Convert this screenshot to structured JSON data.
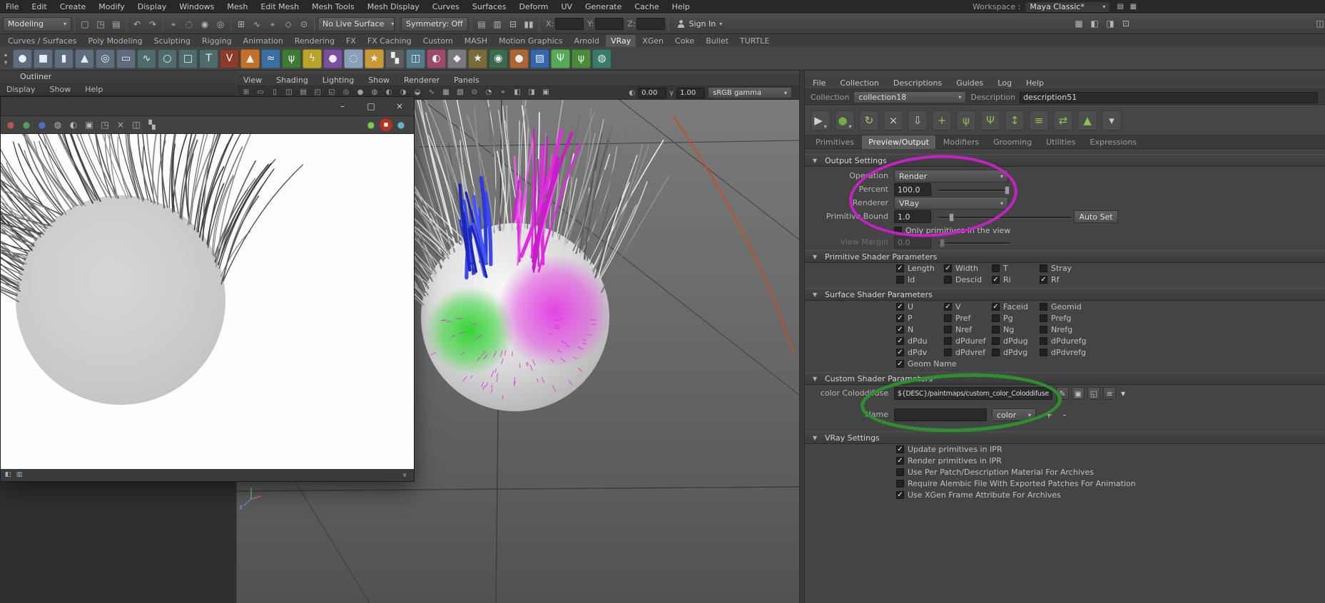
{
  "app": {
    "workspace_label": "Workspace :",
    "workspace_value": "Maya Classic*"
  },
  "menubar": {
    "items": [
      "File",
      "Edit",
      "Create",
      "Modify",
      "Display",
      "Windows",
      "Mesh",
      "Edit Mesh",
      "Mesh Tools",
      "Mesh Display",
      "Curves",
      "Surfaces",
      "Deform",
      "UV",
      "Generate",
      "Cache",
      "Help"
    ],
    "right_icons": [
      {
        "name": "workspace-options-icon",
        "glyph": "▤"
      },
      {
        "name": "layout-switch-icon",
        "glyph": "▦"
      }
    ]
  },
  "statusline": {
    "mode": "Modeling",
    "no_live_surface": "No Live Surface",
    "symmetry": "Symmetry: Off",
    "sign_in_label": "Sign In",
    "far_right_icon_glyph": "◫",
    "coords": {
      "x_label": "X:",
      "y_label": "Y:",
      "z_label": "Z:"
    },
    "file_icons": [
      {
        "name": "new-scene-icon",
        "glyph": "▢"
      },
      {
        "name": "open-scene-icon",
        "glyph": "◳"
      },
      {
        "name": "save-scene-icon",
        "glyph": "▤"
      }
    ],
    "undo_icons": [
      {
        "name": "undo-icon",
        "glyph": "↶"
      },
      {
        "name": "redo-icon",
        "glyph": "↷"
      }
    ],
    "select_icons": [
      {
        "name": "select-tool-icon",
        "glyph": "⌖"
      },
      {
        "name": "lasso-select-icon",
        "glyph": "◌"
      },
      {
        "name": "select-hierarchy-icon",
        "glyph": "◉"
      },
      {
        "name": "select-object-icon",
        "glyph": "◎"
      }
    ],
    "snap_icons": [
      {
        "name": "snap-grid-icon",
        "glyph": "⊞"
      },
      {
        "name": "snap-curve-icon",
        "glyph": "∿"
      },
      {
        "name": "snap-point-icon",
        "glyph": "⌖"
      },
      {
        "name": "snap-plane-icon",
        "glyph": "◇"
      },
      {
        "name": "snap-surface-icon",
        "glyph": "⊙"
      }
    ],
    "history_icons": [
      {
        "name": "construction-history-icon",
        "glyph": "▤"
      },
      {
        "name": "selection-highlight-icon",
        "glyph": "▥"
      },
      {
        "name": "evaluation-icon",
        "glyph": "⊟"
      },
      {
        "name": "pause-evaluation-icon",
        "glyph": "▮▮"
      }
    ],
    "render_icons": [
      {
        "name": "open-render-view-icon",
        "glyph": "▦"
      },
      {
        "name": "render-frame-icon",
        "glyph": "◧"
      },
      {
        "name": "ipr-render-icon",
        "glyph": "◨"
      },
      {
        "name": "render-settings-icon",
        "glyph": "⊡"
      }
    ]
  },
  "shelf": {
    "active_tab": "VRay",
    "tabs": [
      "Curves / Surfaces",
      "Poly Modeling",
      "Sculpting",
      "Rigging",
      "Animation",
      "Rendering",
      "FX",
      "FX Caching",
      "Custom",
      "MASH",
      "Motion Graphics",
      "Arnold",
      "VRay",
      "XGen",
      "Coke",
      "Bullet",
      "TURTLE"
    ],
    "left_icons": [
      {
        "name": "shelf-scroll-up-icon",
        "glyph": "▴"
      },
      {
        "name": "shelf-scroll-down-icon",
        "glyph": "▾"
      }
    ],
    "icons": [
      {
        "name": "shelf-sphere-icon",
        "glyph": "●",
        "color": "#5d6d7d"
      },
      {
        "name": "shelf-cube-icon",
        "glyph": "■",
        "color": "#5d6d7d"
      },
      {
        "name": "shelf-cylinder-icon",
        "glyph": "▮",
        "color": "#5d6d7d"
      },
      {
        "name": "shelf-cone-icon",
        "glyph": "▲",
        "color": "#5d6d7d"
      },
      {
        "name": "shelf-torus-icon",
        "glyph": "◎",
        "color": "#5d6d7d"
      },
      {
        "name": "shelf-plane-icon",
        "glyph": "▭",
        "color": "#5d6d7d"
      },
      {
        "name": "shelf-curve-icon",
        "glyph": "∿",
        "color": "#4f6a6a"
      },
      {
        "name": "shelf-circle-icon",
        "glyph": "○",
        "color": "#4f6a6a"
      },
      {
        "name": "shelf-square-icon",
        "glyph": "□",
        "color": "#4f6a6a"
      },
      {
        "name": "shelf-text-icon",
        "glyph": "T",
        "color": "#4f6a6a"
      },
      {
        "name": "shelf-vray-icon",
        "glyph": "V",
        "color": "#8a3b2a"
      },
      {
        "name": "shelf-fire-icon",
        "glyph": "▲",
        "color": "#c4702b"
      },
      {
        "name": "shelf-water-icon",
        "glyph": "≈",
        "color": "#3b6fa0"
      },
      {
        "name": "shelf-grass-icon",
        "glyph": "ψ",
        "color": "#3f7a35"
      },
      {
        "name": "shelf-lightning-icon",
        "glyph": "ϟ",
        "color": "#b8a42b"
      },
      {
        "name": "shelf-purple-sphere-icon",
        "glyph": "●",
        "color": "#7a4fa0"
      },
      {
        "name": "shelf-cloud-icon",
        "glyph": "◌",
        "color": "#8aa0b8"
      },
      {
        "name": "shelf-sun-icon",
        "glyph": "★",
        "color": "#c79a35"
      },
      {
        "name": "shelf-checker-icon",
        "glyph": "▚",
        "color": "#5d5d5d"
      },
      {
        "name": "shelf-glass-icon",
        "glyph": "◫",
        "color": "#527a8a"
      },
      {
        "name": "shelf-shader-ball-icon",
        "glyph": "◐",
        "color": "#9a4a6a"
      },
      {
        "name": "shelf-metal-icon",
        "glyph": "◆",
        "color": "#77797c"
      },
      {
        "name": "shelf-light-icon",
        "glyph": "★",
        "color": "#7a6a3a"
      },
      {
        "name": "shelf-camera-icon",
        "glyph": "◉",
        "color": "#3a6a4a"
      },
      {
        "name": "shelf-bullet-icon",
        "glyph": "●",
        "color": "#aa6633"
      },
      {
        "name": "shelf-cloth-icon",
        "glyph": "▨",
        "color": "#3366aa"
      },
      {
        "name": "shelf-hair-icon",
        "glyph": "Ψ",
        "color": "#55aa55"
      },
      {
        "name": "shelf-xgen-icon",
        "glyph": "ψ",
        "color": "#4a8a3a"
      },
      {
        "name": "shelf-turtle-icon",
        "glyph": "◍",
        "color": "#3a7a6a"
      }
    ]
  },
  "outliner": {
    "title": "Outliner",
    "menus": [
      "Display",
      "Show",
      "Help"
    ]
  },
  "render_window": {
    "buttons": {
      "minimize": "–",
      "maximize": "□",
      "close": "×"
    },
    "toolbar_left": [
      {
        "name": "red-channel-icon",
        "glyph": "●",
        "fg": "#c05050"
      },
      {
        "name": "green-channel-icon",
        "glyph": "●",
        "fg": "#50a050"
      },
      {
        "name": "blue-channel-icon",
        "glyph": "●",
        "fg": "#5070c0"
      },
      {
        "name": "alpha-channel-icon",
        "glyph": "◍"
      },
      {
        "name": "mono-channel-icon",
        "glyph": "◐"
      },
      {
        "name": "save-image-icon",
        "glyph": "▣"
      },
      {
        "name": "load-image-icon",
        "glyph": "◳"
      },
      {
        "name": "clear-image-icon",
        "glyph": "×"
      },
      {
        "name": "compare-images-icon",
        "glyph": "◫"
      },
      {
        "name": "checker-background-icon",
        "glyph": "▚"
      }
    ],
    "toolbar_right": [
      {
        "name": "render-last-icon",
        "glyph": "●",
        "fg": "#7ec850"
      },
      {
        "name": "stop-render-icon",
        "glyph": "◼",
        "fg": "#ffffff",
        "color": "#b23325",
        "cls": "round"
      },
      {
        "name": "region-render-icon",
        "glyph": "●",
        "fg": "#58b8cc"
      }
    ],
    "bottom_icons": [
      {
        "name": "image-info-icon",
        "glyph": "◧",
        "fg": "#8fb8d8"
      },
      {
        "name": "histogram-icon",
        "glyph": "▥",
        "fg": "#8fb8d8"
      }
    ],
    "expand_glyph": "»"
  },
  "viewport": {
    "menus": [
      "View",
      "Shading",
      "Lighting",
      "Show",
      "Renderer",
      "Panels"
    ],
    "toolbar_icons": [
      {
        "name": "grid-toggle-icon",
        "glyph": "⊞"
      },
      {
        "name": "film-gate-icon",
        "glyph": "▭"
      },
      {
        "name": "resolution-gate-icon",
        "glyph": "▯"
      },
      {
        "name": "gate-mask-icon",
        "glyph": "◫"
      },
      {
        "name": "field-chart-icon",
        "glyph": "▤"
      },
      {
        "name": "safe-action-icon",
        "glyph": "◰"
      },
      {
        "name": "safe-title-icon",
        "glyph": "◱"
      },
      {
        "name": "wireframe-icon",
        "glyph": "◎"
      },
      {
        "name": "shaded-mode-icon",
        "glyph": "●"
      },
      {
        "name": "textured-mode-icon",
        "glyph": "◍"
      },
      {
        "name": "use-all-lights-icon",
        "glyph": "◐"
      },
      {
        "name": "shadows-icon",
        "glyph": "◑"
      },
      {
        "name": "ambient-occlusion-icon",
        "glyph": "◒"
      },
      {
        "name": "motion-blur-icon",
        "glyph": "∿"
      },
      {
        "name": "anti-alias-icon",
        "glyph": "▦"
      },
      {
        "name": "depth-of-field-icon",
        "glyph": "▧"
      },
      {
        "name": "isolate-select-icon",
        "glyph": "⊙"
      },
      {
        "name": "xray-icon",
        "glyph": "◔"
      },
      {
        "name": "joint-xray-icon",
        "glyph": "⌖"
      },
      {
        "name": "exposure-toggle-icon",
        "glyph": "◧"
      },
      {
        "name": "gamma-toggle-icon",
        "glyph": "◨"
      },
      {
        "name": "snapshot-icon",
        "glyph": "▣"
      }
    ],
    "exposure_icon": "◐",
    "exposure": "0.00",
    "gamma_icon": "γ",
    "gamma": "1.00",
    "view_transform": "sRGB gamma"
  },
  "xgen": {
    "menus": [
      "File",
      "Collection",
      "Descriptions",
      "Guides",
      "Log",
      "Help"
    ],
    "collection_label": "Collection",
    "collection_value": "collection18",
    "description_label": "Description",
    "description_value": "description51",
    "toolbar_icons": [
      {
        "name": "xgen-select-icon",
        "glyph": "▶",
        "fg": "#cfcfcf",
        "arrow": true
      },
      {
        "name": "xgen-preview-icon",
        "glyph": "●",
        "fg": "#6fae3f",
        "arrow": true
      },
      {
        "name": "xgen-refresh-icon",
        "glyph": "↻",
        "fg": "#9fce6a"
      },
      {
        "name": "xgen-clear-icon",
        "glyph": "×",
        "fg": "#c8c8c8"
      },
      {
        "name": "xgen-export-icon",
        "glyph": "⇩",
        "fg": "#c8c8c8"
      },
      {
        "name": "xgen-add-guide-icon",
        "glyph": "+",
        "fg": "#8cc152"
      },
      {
        "name": "xgen-guide-icon",
        "glyph": "ψ",
        "fg": "#8cc152"
      },
      {
        "name": "xgen-comb-icon",
        "glyph": "Ψ",
        "fg": "#8cc152"
      },
      {
        "name": "xgen-length-icon",
        "glyph": "↕",
        "fg": "#8cc152"
      },
      {
        "name": "xgen-density-icon",
        "glyph": "≡",
        "fg": "#8cc152"
      },
      {
        "name": "xgen-convert-icon",
        "glyph": "⇄",
        "fg": "#8cc152"
      },
      {
        "name": "xgen-lock-icon",
        "glyph": "▲",
        "fg": "#8cc152"
      },
      {
        "name": "xgen-more-icon",
        "glyph": "▾",
        "fg": "#c8c8c8"
      }
    ],
    "tabs": [
      "Primitives",
      "Preview/Output",
      "Modifiers",
      "Grooming",
      "Utilities",
      "Expressions"
    ],
    "active_tab": "Preview/Output",
    "output": {
      "title": "Output Settings",
      "operation_label": "Operation",
      "operation_value": "Render",
      "percent_label": "Percent",
      "percent_value": "100.0",
      "renderer_label": "Renderer",
      "renderer_value": "VRay",
      "primitive_bound_label": "Primitive Bound",
      "primitive_bound_value": "1.0",
      "auto_set_label": "Auto Set",
      "only_primitives": [
        {
          "label": "Only primitives in the view",
          "checked": false
        }
      ],
      "view_margin_label": "View Margin",
      "view_margin_value": "0.0"
    },
    "primitive_shader": {
      "title": "Primitive Shader Parameters",
      "checkboxes": [
        {
          "label": "Length",
          "checked": true
        },
        {
          "label": "Width",
          "checked": true
        },
        {
          "label": "T",
          "checked": false
        },
        {
          "label": "Stray",
          "checked": false
        },
        {
          "label": "Id",
          "checked": false
        },
        {
          "label": "Descid",
          "checked": false
        },
        {
          "label": "Ri",
          "checked": true
        },
        {
          "label": "Rf",
          "checked": true
        }
      ]
    },
    "surface_shader": {
      "title": "Surface Shader Parameters",
      "checkboxes": [
        {
          "label": "U",
          "checked": true
        },
        {
          "label": "V",
          "checked": true
        },
        {
          "label": "Faceid",
          "checked": true
        },
        {
          "label": "Geomid",
          "checked": false
        },
        {
          "label": "P",
          "checked": true
        },
        {
          "label": "Pref",
          "checked": false
        },
        {
          "label": "Pg",
          "checked": false
        },
        {
          "label": "Prefg",
          "checked": false
        },
        {
          "label": "N",
          "checked": true
        },
        {
          "label": "Nref",
          "checked": false
        },
        {
          "label": "Ng",
          "checked": false
        },
        {
          "label": "Nrefg",
          "checked": false
        },
        {
          "label": "dPdu",
          "checked": true
        },
        {
          "label": "dPduref",
          "checked": false
        },
        {
          "label": "dPdug",
          "checked": false
        },
        {
          "label": "dPdurefg",
          "checked": false
        },
        {
          "label": "dPdv",
          "checked": true
        },
        {
          "label": "dPdvref",
          "checked": false
        },
        {
          "label": "dPdvg",
          "checked": false
        },
        {
          "label": "dPdvrefg",
          "checked": false
        },
        {
          "label": "Geom Name",
          "checked": true
        }
      ]
    },
    "custom_shader": {
      "title": "Custom Shader Parameters",
      "color_label": "color Coloddifuse",
      "color_value": "${DESC}/paintmaps/custom_color_Coloddifuse",
      "paint_icon": "✎",
      "save_icon": "▣",
      "folder_icon": "◱",
      "options_icon": "≡",
      "expand_icon": "▾",
      "name_label": "Name",
      "name_value": "",
      "type_value": "color",
      "add_label": "+",
      "remove_label": "-"
    },
    "vray_settings": {
      "title": "VRay Settings",
      "checkboxes": [
        {
          "label": "Update primitives in IPR",
          "checked": true
        },
        {
          "label": "Render primitives in IPR",
          "checked": true
        },
        {
          "label": "Use Per Patch/Description Material For Archives",
          "checked": false
        },
        {
          "label": "Require Alembic File With Exported Patches For Animation",
          "checked": false
        },
        {
          "label": "Use XGen Frame Attribute For Archives",
          "checked": true
        }
      ]
    }
  },
  "annotations": {
    "magenta": "#c521c5",
    "green": "#2f8f2f"
  },
  "scene": {
    "sphere_color": "#d9d9d9",
    "green_patch": "#2bd42b",
    "magenta_patch": "#e238e2",
    "blue_hair": "#2c38e0",
    "magenta_hair": "#e02be0",
    "gray_hair": "#b5b5b5",
    "curve_color": "#c0502a"
  }
}
